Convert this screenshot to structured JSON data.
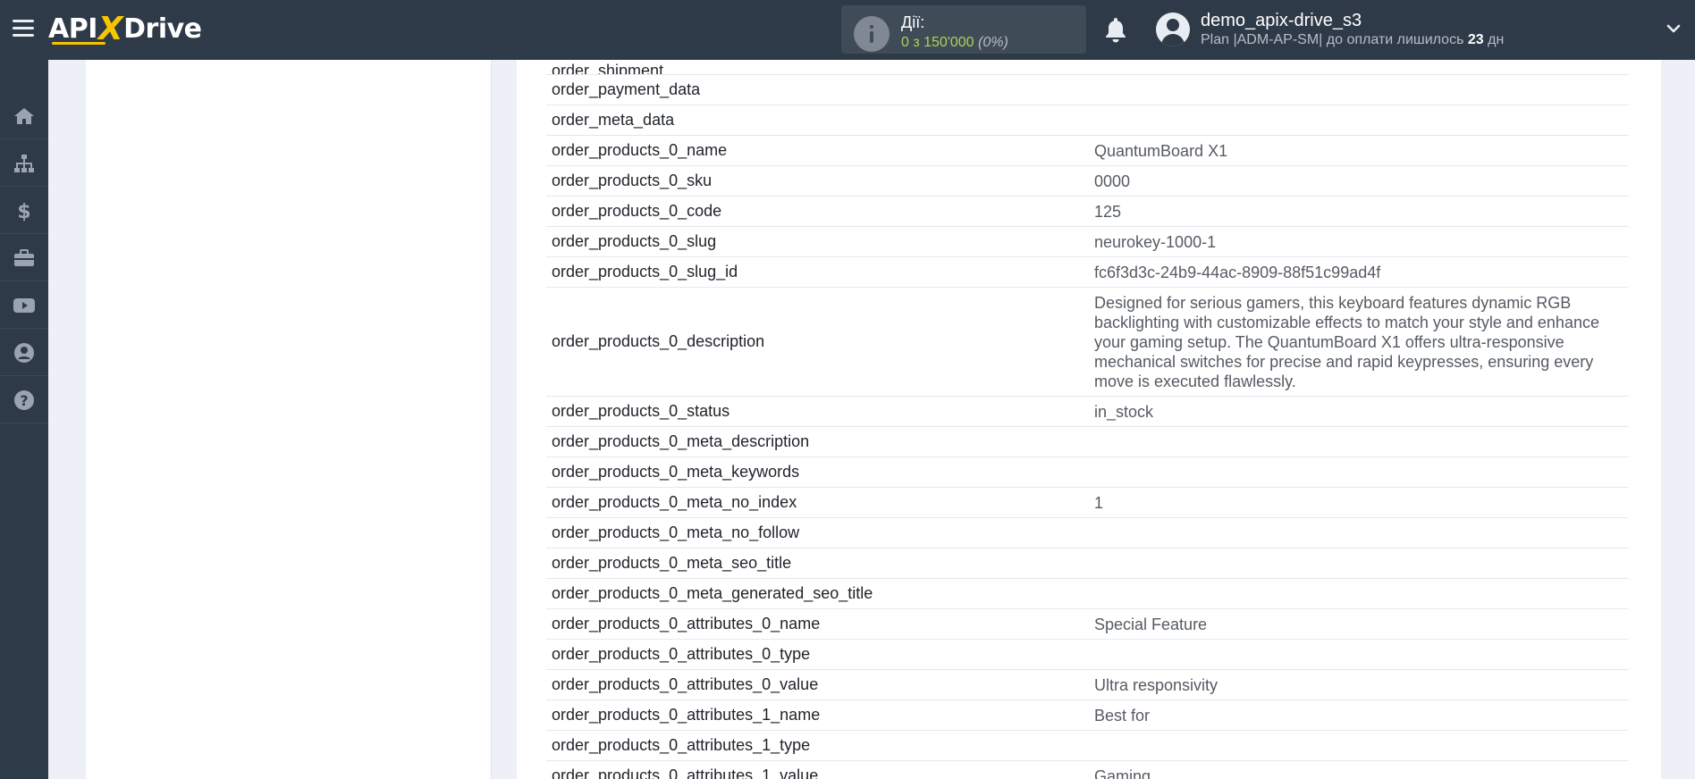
{
  "header": {
    "logo_text_left": "API",
    "logo_x": "X",
    "logo_text_right": "Drive",
    "actions": {
      "title": "Дії:",
      "count": "0 з 150'000",
      "percent": "(0%)"
    },
    "user": {
      "name": "demo_apix-drive_s3",
      "plan_prefix": "Plan |ADM-AP-SM| до оплати лишилось ",
      "days": "23",
      "days_suffix": " дн"
    }
  },
  "sidenav": {
    "items": [
      "home-icon",
      "sitemap-icon",
      "dollar-icon",
      "briefcase-icon",
      "youtube-icon",
      "user-circle-icon",
      "question-icon"
    ]
  },
  "table": {
    "top_partial_key": "order_shipment",
    "rows": [
      {
        "key": "order_payment_data",
        "value": ""
      },
      {
        "key": "order_meta_data",
        "value": ""
      },
      {
        "key": "order_products_0_name",
        "value": "QuantumBoard X1"
      },
      {
        "key": "order_products_0_sku",
        "value": "0000"
      },
      {
        "key": "order_products_0_code",
        "value": "125"
      },
      {
        "key": "order_products_0_slug",
        "value": "neurokey-1000-1"
      },
      {
        "key": "order_products_0_slug_id",
        "value": "fc6f3d3c-24b9-44ac-8909-88f51c99ad4f"
      },
      {
        "key": "order_products_0_description",
        "value": "Designed for serious gamers, this keyboard features dynamic RGB backlighting with customizable effects to match your style and enhance your gaming setup. The QuantumBoard X1 offers ultra-responsive mechanical switches for precise and rapid keypresses, ensuring every move is executed flawlessly."
      },
      {
        "key": "order_products_0_status",
        "value": "in_stock"
      },
      {
        "key": "order_products_0_meta_description",
        "value": ""
      },
      {
        "key": "order_products_0_meta_keywords",
        "value": ""
      },
      {
        "key": "order_products_0_meta_no_index",
        "value": "1"
      },
      {
        "key": "order_products_0_meta_no_follow",
        "value": ""
      },
      {
        "key": "order_products_0_meta_seo_title",
        "value": ""
      },
      {
        "key": "order_products_0_meta_generated_seo_title",
        "value": ""
      },
      {
        "key": "order_products_0_attributes_0_name",
        "value": "Special Feature"
      },
      {
        "key": "order_products_0_attributes_0_type",
        "value": ""
      },
      {
        "key": "order_products_0_attributes_0_value",
        "value": "Ultra responsivity"
      },
      {
        "key": "order_products_0_attributes_1_name",
        "value": "Best for"
      },
      {
        "key": "order_products_0_attributes_1_type",
        "value": ""
      },
      {
        "key": "order_products_0_attributes_1_value",
        "value": "Gaming"
      }
    ]
  }
}
